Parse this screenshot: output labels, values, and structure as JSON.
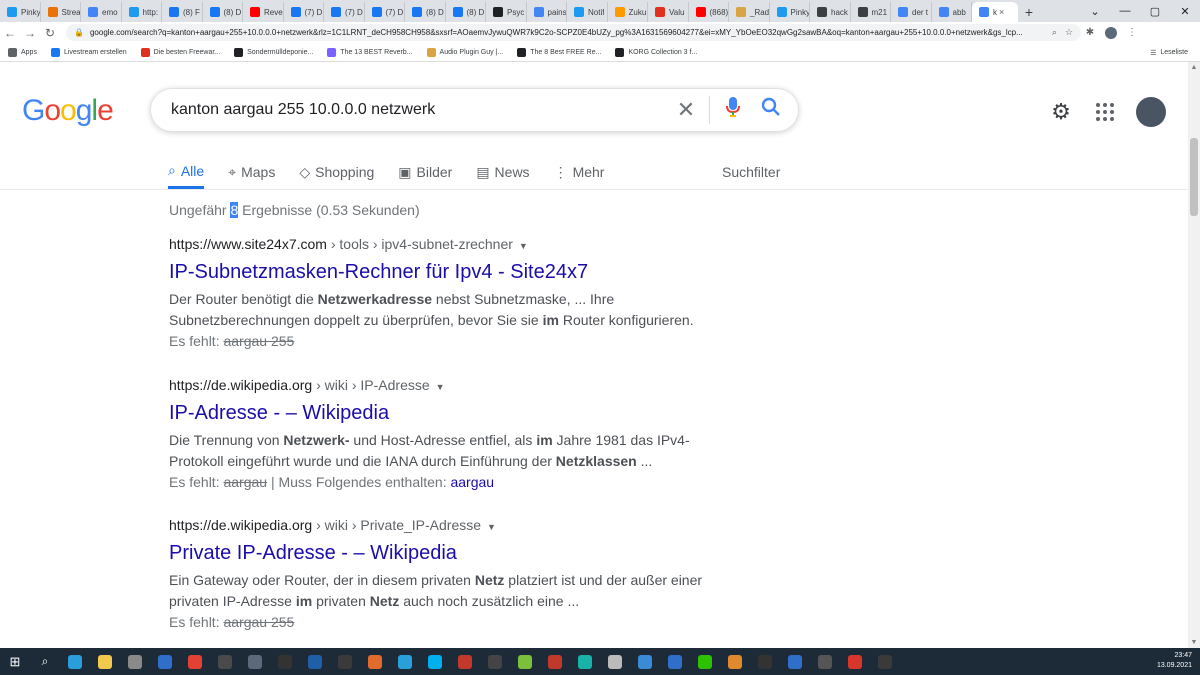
{
  "browser": {
    "tabs": [
      {
        "label": "Pinky",
        "color": "#1d9bf0"
      },
      {
        "label": "Strea",
        "color": "#e8710a"
      },
      {
        "label": "emo",
        "color": "#4285f4"
      },
      {
        "label": "http:",
        "color": "#1d9bf0"
      },
      {
        "label": "(8) F",
        "color": "#1877f2"
      },
      {
        "label": "(8) D",
        "color": "#1877f2"
      },
      {
        "label": "Reve",
        "color": "#ff0000"
      },
      {
        "label": "(7) D",
        "color": "#1877f2"
      },
      {
        "label": "(7) D",
        "color": "#1877f2"
      },
      {
        "label": "(7) D",
        "color": "#1877f2"
      },
      {
        "label": "(8) D",
        "color": "#1877f2"
      },
      {
        "label": "(8) D",
        "color": "#1877f2"
      },
      {
        "label": "Psyc",
        "color": "#202124"
      },
      {
        "label": "pains",
        "color": "#4285f4"
      },
      {
        "label": "Notif",
        "color": "#1d9bf0"
      },
      {
        "label": "Zuku",
        "color": "#ff9900"
      },
      {
        "label": "Valu",
        "color": "#e0301e"
      },
      {
        "label": "(868)",
        "color": "#ff0000"
      },
      {
        "label": "_Rad",
        "color": "#d9a441"
      },
      {
        "label": "Pinky",
        "color": "#1d9bf0"
      },
      {
        "label": "hack",
        "color": "#3c4043"
      },
      {
        "label": "m21",
        "color": "#3c4043"
      },
      {
        "label": "der t",
        "color": "#4285f4"
      },
      {
        "label": "abb",
        "color": "#4285f4"
      },
      {
        "label": "k",
        "color": "#4285f4",
        "active": true
      }
    ],
    "tab_close": "×",
    "new_tab": "+",
    "window_controls": {
      "tabsearch": "⌄",
      "minimize": "—",
      "maximize": "▢",
      "close": "✕"
    },
    "nav": {
      "back": "←",
      "forward": "→",
      "reload": "↻"
    },
    "url": "google.com/search?q=kanton+aargau+255+10.0.0.0+netzwerk&rlz=1C1LRNT_deCH958CH958&sxsrf=AOaemvJywuQWR7k9C2o-SCPZ0E4bUZy_pg%3A1631569604277&ei=xMY_YbOeEO32qwGg2sawBA&oq=kanton+aargau+255+10.0.0.0+netzwerk&gs_lcp...",
    "bookmarks": [
      {
        "label": "Apps",
        "color": "#5f6368"
      },
      {
        "label": "Livestream erstellen",
        "color": "#1877f2"
      },
      {
        "label": "Die besten Freewar...",
        "color": "#e0301e"
      },
      {
        "label": "Sondermülldeponie...",
        "color": "#202124"
      },
      {
        "label": "The 13 BEST Reverb...",
        "color": "#7b61ff"
      },
      {
        "label": "Audio Plugin Guy |...",
        "color": "#d9a441"
      },
      {
        "label": "The 8 Best FREE Re...",
        "color": "#202124"
      },
      {
        "label": "KORG Collection 3 f...",
        "color": "#202124"
      }
    ],
    "reading_list": "Leseliste"
  },
  "google": {
    "logo": "Google",
    "query": "kanton aargau 255 10.0.0.0 netzwerk",
    "nav_tabs": [
      {
        "label": "Alle",
        "icon": "search-icon",
        "active": true
      },
      {
        "label": "Maps",
        "icon": "map-pin-icon"
      },
      {
        "label": "Shopping",
        "icon": "tag-icon"
      },
      {
        "label": "Bilder",
        "icon": "image-icon"
      },
      {
        "label": "News",
        "icon": "news-icon"
      },
      {
        "label": "Mehr",
        "icon": "more-icon"
      }
    ],
    "tools": "Suchfilter",
    "stats": {
      "prefix": "Ungefähr ",
      "count": "8",
      "suffix": " Ergebnisse (0.53 Sekunden)"
    },
    "results": [
      {
        "domain": "https://www.site24x7.com",
        "path": " › tools › ipv4-subnet-zrechner",
        "title": "IP-Subnetzmasken-Rechner für Ipv4 - Site24x7",
        "snippet": [
          {
            "t": "Der Router benötigt die "
          },
          {
            "t": "Netzwerkadresse",
            "b": true
          },
          {
            "t": " nebst Subnetzmaske, ... Ihre Subnetzberechnungen doppelt zu überprüfen, bevor Sie sie "
          },
          {
            "t": "im",
            "b": true
          },
          {
            "t": " Router konfigurieren."
          }
        ],
        "missing_label": "Es fehlt: ",
        "missing_terms": "aargau 255",
        "must_include": ""
      },
      {
        "domain": "https://de.wikipedia.org",
        "path": " › wiki › IP-Adresse",
        "title": "IP-Adresse - – Wikipedia",
        "snippet": [
          {
            "t": "Die Trennung von "
          },
          {
            "t": "Netzwerk-",
            "b": true
          },
          {
            "t": " und Host-Adresse entfiel, als "
          },
          {
            "t": "im",
            "b": true
          },
          {
            "t": " Jahre 1981 das IPv4-Protokoll eingeführt wurde und die IANA durch Einführung der "
          },
          {
            "t": "Netzklassen",
            "b": true
          },
          {
            "t": " ..."
          }
        ],
        "missing_label": "Es fehlt: ",
        "missing_terms": "aargau",
        "must_include": " | Muss Folgendes enthalten: ",
        "must_include_link": "aargau"
      },
      {
        "domain": "https://de.wikipedia.org",
        "path": " › wiki › Private_IP-Adresse",
        "title": "Private IP-Adresse - – Wikipedia",
        "snippet": [
          {
            "t": "Ein Gateway oder Router, der in diesem privaten "
          },
          {
            "t": "Netz",
            "b": true
          },
          {
            "t": " platziert ist und der außer einer privaten IP-Adresse "
          },
          {
            "t": "im",
            "b": true
          },
          {
            "t": " privaten "
          },
          {
            "t": "Netz",
            "b": true
          },
          {
            "t": " auch noch zusätzlich eine ..."
          }
        ],
        "missing_label": "Es fehlt: ",
        "missing_terms": "aargau 255",
        "must_include": ""
      }
    ]
  },
  "taskbar": {
    "apps": [
      {
        "name": "edge",
        "color": "#2b9dd8"
      },
      {
        "name": "explorer",
        "color": "#f2c94c"
      },
      {
        "name": "store",
        "color": "#8a8a8a"
      },
      {
        "name": "mail",
        "color": "#2f6fc9"
      },
      {
        "name": "chrome",
        "color": "#e34133"
      },
      {
        "name": "app1",
        "color": "#4a4a4a"
      },
      {
        "name": "app2",
        "color": "#5a6a7a"
      },
      {
        "name": "live",
        "color": "#333333"
      },
      {
        "name": "app3",
        "color": "#1f5fa8"
      },
      {
        "name": "app4",
        "color": "#3a3a3a"
      },
      {
        "name": "app5",
        "color": "#e06b2d"
      },
      {
        "name": "telegram",
        "color": "#2aa0da"
      },
      {
        "name": "skype",
        "color": "#00aff0"
      },
      {
        "name": "app6",
        "color": "#c0392b"
      },
      {
        "name": "app7",
        "color": "#444444"
      },
      {
        "name": "app8",
        "color": "#7bbf3a"
      },
      {
        "name": "app9",
        "color": "#c0392b"
      },
      {
        "name": "app10",
        "color": "#19b2a8"
      },
      {
        "name": "app11",
        "color": "#bbbbbb"
      },
      {
        "name": "app12",
        "color": "#3a8ad6"
      },
      {
        "name": "app13",
        "color": "#2f6fc9"
      },
      {
        "name": "wechat",
        "color": "#2dc100"
      },
      {
        "name": "app14",
        "color": "#e08a2d"
      },
      {
        "name": "app15",
        "color": "#333333"
      },
      {
        "name": "app16",
        "color": "#2f6fc9"
      },
      {
        "name": "app17",
        "color": "#555555"
      },
      {
        "name": "app18",
        "color": "#d9362b"
      },
      {
        "name": "app19",
        "color": "#3a3a3a"
      }
    ],
    "time": "23:47",
    "date": "13.09.2021"
  }
}
